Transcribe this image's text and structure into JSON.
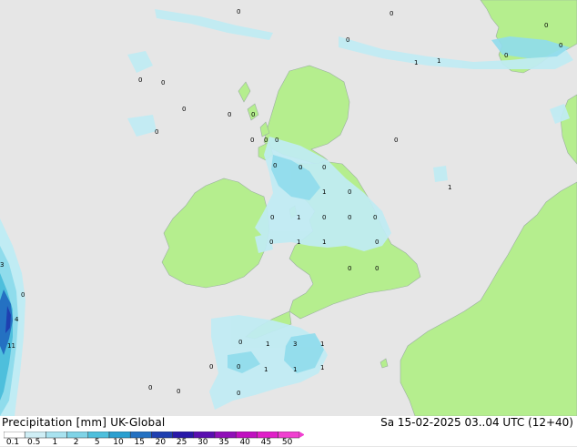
{
  "map": {
    "precip_labels": [
      "0",
      "0",
      "0",
      "0",
      "0",
      "0",
      "0",
      "0",
      "0",
      "0",
      "1",
      "1",
      "0",
      "0",
      "0",
      "0",
      "0",
      "0",
      "0",
      "0",
      "0",
      "1",
      "1",
      "0",
      "0",
      "1",
      "0",
      "0",
      "0",
      "0",
      "1",
      "1",
      "0",
      "0",
      "0",
      "3",
      "0",
      "4",
      "11",
      "0",
      "1",
      "3",
      "1",
      "0",
      "0",
      "1",
      "1",
      "1",
      "0",
      "0",
      "0"
    ]
  },
  "legend": {
    "title": "Precipitation [mm]",
    "model": "UK-Global",
    "valid_time": "Sa 15-02-2025 03..04 UTC (12+40)",
    "ticks": [
      "0.1",
      "0.5",
      "1",
      "2",
      "5",
      "10",
      "15",
      "20",
      "25",
      "30",
      "35",
      "40",
      "45",
      "50"
    ],
    "colors": [
      "#ffffff",
      "#cfeef5",
      "#a8e2ef",
      "#7fd3e6",
      "#4ebfdc",
      "#2a9fd0",
      "#2471c2",
      "#1e3fb0",
      "#2818a8",
      "#5a0fb0",
      "#9010b8",
      "#c010c0",
      "#e020c8",
      "#f040d0"
    ]
  },
  "colors": {
    "sea": "#e6e6e6",
    "land": "#b5ee8e",
    "light_rain": "#c0ecf4",
    "rain": "#8fdcec",
    "heavy_rain": "#2a7fd0"
  }
}
